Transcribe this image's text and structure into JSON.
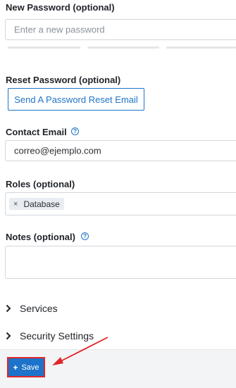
{
  "new_password": {
    "label": "New Password (optional)",
    "placeholder": "Enter a new password"
  },
  "reset_password": {
    "label": "Reset Password (optional)",
    "button_label": "Send A Password Reset Email"
  },
  "contact_email": {
    "label": "Contact Email",
    "help_icon": "?",
    "value": "correo@ejemplo.com"
  },
  "roles": {
    "label": "Roles (optional)",
    "tags": [
      {
        "remove": "×",
        "label": "Database"
      }
    ]
  },
  "notes": {
    "label": "Notes (optional)",
    "help_icon": "?",
    "value": ""
  },
  "sections": {
    "services": {
      "label": "Services",
      "chevron": "›"
    },
    "security_settings": {
      "label": "Security Settings",
      "chevron": "›"
    }
  },
  "footer": {
    "save_icon": "+",
    "save_label": "Save"
  },
  "colors": {
    "accent": "#1d73c9",
    "highlight": "#e0262a"
  }
}
